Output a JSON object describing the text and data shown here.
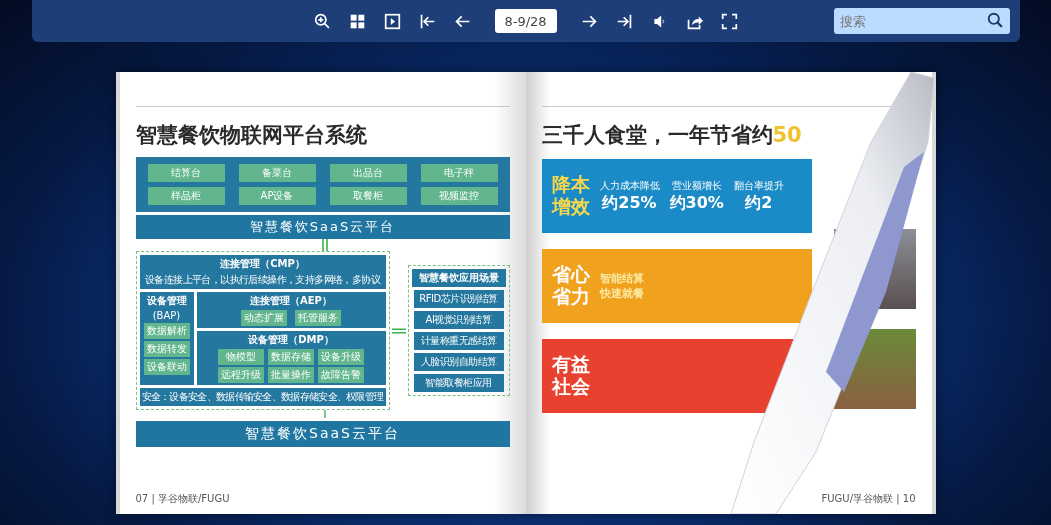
{
  "toolbar": {
    "page_field": {
      "value": "8-9/28"
    },
    "search": {
      "placeholder": "搜索"
    }
  },
  "left_page": {
    "title": "智慧餐饮物联网平台系统",
    "devices": [
      "结算台",
      "备菜台",
      "出品台",
      "电子秤",
      "样品柜",
      "AP设备",
      "取餐柜",
      "视频监控"
    ],
    "platform_top": "智慧餐饮SaaS云平台",
    "cmp": {
      "title": "连接管理（CMP）",
      "desc": "设备连接上平台，以执行后续操作，支持多网络，多协议"
    },
    "bap": {
      "title": "设备管理",
      "subtitle": "(BAP)",
      "items": [
        "数据解析",
        "数据转发",
        "设备联动"
      ]
    },
    "aep": {
      "title": "连接管理（AEP）",
      "items": [
        "动态扩展",
        "托管服务"
      ]
    },
    "dmp": {
      "title": "设备管理（DMP）",
      "items": [
        "物模型",
        "数据存储",
        "设备升级",
        "远程升级",
        "批量操作",
        "故障告警"
      ]
    },
    "security": "安全：设备安全、数据传输安全、数据存储安全、权限管理",
    "scenarios": {
      "title": "智慧餐饮应用场景",
      "items": [
        "RFID芯片识别结算",
        "AI视觉识别结算",
        "计量称重无感结算",
        "人脸识别自助结算",
        "智能取餐柜应用"
      ]
    },
    "platform_bottom": "智慧餐饮SaaS云平台",
    "footer": "07 | 孚谷物联/FUGU"
  },
  "right_page": {
    "title": "三千人食堂，一年节省约",
    "title_highlight": "50",
    "panels": [
      {
        "kind": "stats",
        "color": "#1a8bc6",
        "heading": [
          "降本",
          "增效"
        ],
        "stats": [
          {
            "label": "人力成本降低",
            "value": "约25%"
          },
          {
            "label": "营业额增长",
            "value": "约30%"
          },
          {
            "label": "翻台率提升",
            "value": "约2"
          }
        ]
      },
      {
        "kind": "lines",
        "color": "#f0a21f",
        "heading": [
          "省心",
          "省力"
        ],
        "lines": [
          "智能结算",
          "快速就餐"
        ]
      },
      {
        "kind": "plain",
        "color": "#e8412f",
        "heading": [
          "有益",
          "社会"
        ]
      }
    ],
    "footer": "FUGU/孚谷物联 | 10"
  }
}
